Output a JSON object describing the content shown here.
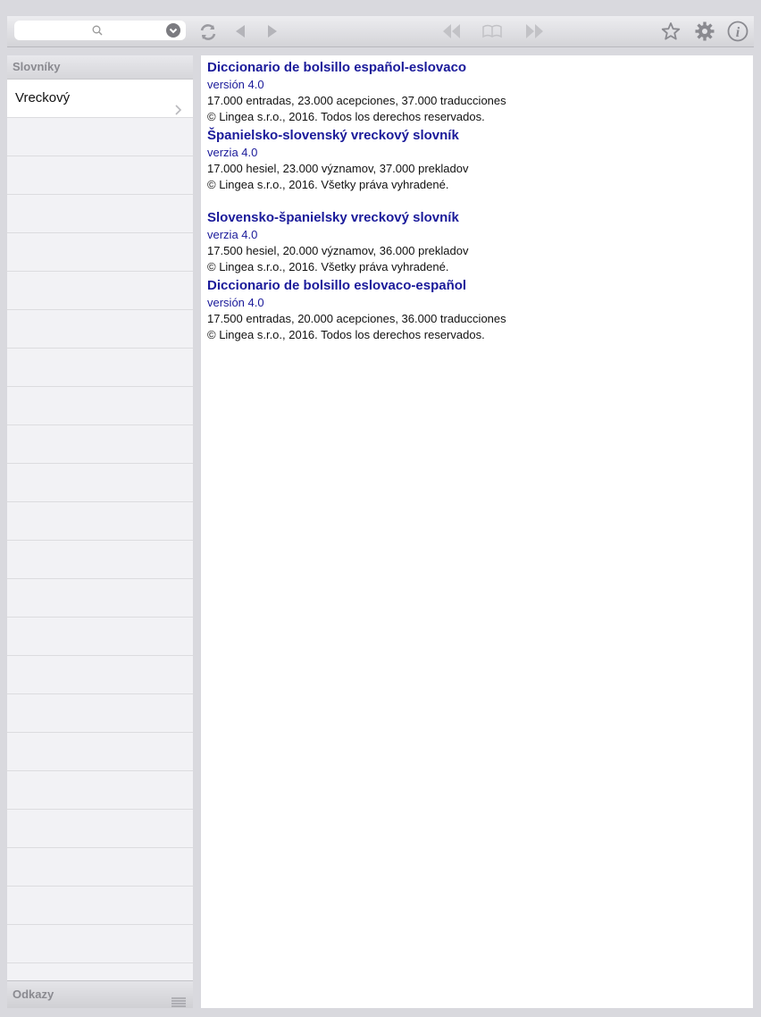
{
  "toolbar": {
    "search_placeholder": "",
    "icons": [
      "search-icon",
      "dropdown-icon",
      "sync-icon",
      "back-icon",
      "forward-icon",
      "rewind-icon",
      "book-icon",
      "fast-forward-icon",
      "star-icon",
      "gear-icon",
      "info-icon"
    ]
  },
  "sidebar": {
    "header": "Slovníky",
    "items": [
      {
        "label": "Vreckový"
      }
    ],
    "footer": "Odkazy"
  },
  "content": {
    "entries": [
      {
        "title": "Diccionario de bolsillo español-eslovaco",
        "version": "versión 4.0",
        "stats": "17.000 entradas, 23.000 acepciones, 37.000 traducciones",
        "copyright": "© Lingea s.r.o., 2016. Todos los derechos reservados."
      },
      {
        "title": "Španielsko-slovenský vreckový slovník",
        "version": "verzia 4.0",
        "stats": "17.000 hesiel, 23.000 významov, 37.000 prekladov",
        "copyright": "© Lingea s.r.o., 2016. Všetky práva vyhradené."
      },
      {
        "title": "Slovensko-španielsky vreckový slovník",
        "version": "verzia 4.0",
        "stats": "17.500 hesiel, 20.000 významov, 36.000 prekladov",
        "copyright": "© Lingea s.r.o., 2016. Všetky práva vyhradené."
      },
      {
        "title": "Diccionario de bolsillo eslovaco-español",
        "version": "versión 4.0",
        "stats": "17.500 entradas, 20.000 acepciones, 36.000 traducciones",
        "copyright": "© Lingea s.r.o., 2016. Todos los derechos reservados."
      }
    ]
  }
}
